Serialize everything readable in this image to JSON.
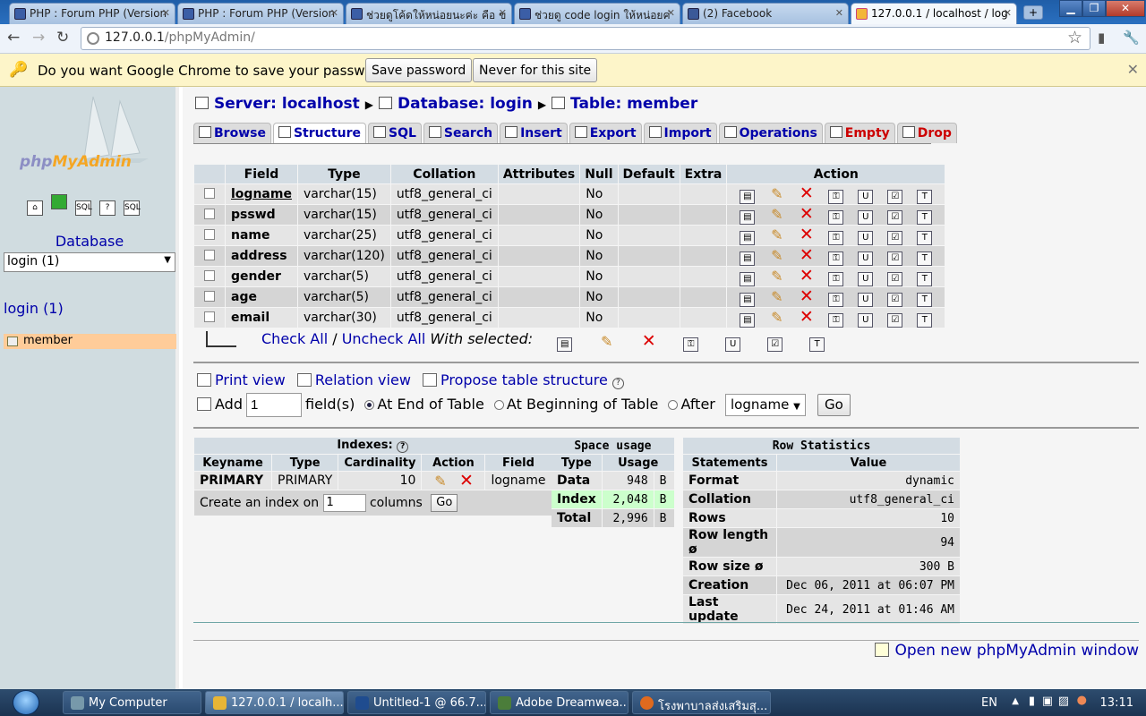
{
  "browser": {
    "tabs": [
      {
        "label": "PHP : Forum PHP (Version",
        "icon": "page-icon"
      },
      {
        "label": "PHP : Forum PHP (Version",
        "icon": "page-icon"
      },
      {
        "label": "ช่วยดูโค้ดให้หน่อยนะค่ะ คือ ข",
        "icon": "page-icon"
      },
      {
        "label": "ช่วยดู code login ให้หน่อยค่",
        "icon": "page-icon"
      },
      {
        "label": "(2) Facebook",
        "icon": "facebook-icon"
      },
      {
        "label": "127.0.0.1 / localhost / log",
        "icon": "phpmyadmin-icon"
      }
    ],
    "url_host": "127.0.0.1",
    "url_path": "/phpMyAdmin/",
    "infobar": {
      "message": "Do you want Google Chrome to save your password?",
      "save_label": "Save password",
      "never_label": "Never for this site"
    }
  },
  "sidebar": {
    "logo": {
      "php": "php",
      "myadmin": "MyAdmin"
    },
    "database_label": "Database",
    "database_selected": "login (1)",
    "db_title": "login (1)",
    "tables": [
      "member"
    ]
  },
  "breadcrumb": {
    "server": "Server: localhost",
    "database": "Database: login",
    "table": "Table: member"
  },
  "tabs": [
    {
      "label": "Browse"
    },
    {
      "label": "Structure"
    },
    {
      "label": "SQL"
    },
    {
      "label": "Search"
    },
    {
      "label": "Insert"
    },
    {
      "label": "Export"
    },
    {
      "label": "Import"
    },
    {
      "label": "Operations"
    },
    {
      "label": "Empty"
    },
    {
      "label": "Drop"
    }
  ],
  "structure": {
    "headers": [
      "Field",
      "Type",
      "Collation",
      "Attributes",
      "Null",
      "Default",
      "Extra",
      "Action"
    ],
    "rows": [
      {
        "field": "logname",
        "type": "varchar(15)",
        "collation": "utf8_general_ci",
        "attributes": "",
        "null": "No",
        "default": "",
        "extra": "",
        "primary": true
      },
      {
        "field": "psswd",
        "type": "varchar(15)",
        "collation": "utf8_general_ci",
        "attributes": "",
        "null": "No",
        "default": "",
        "extra": ""
      },
      {
        "field": "name",
        "type": "varchar(25)",
        "collation": "utf8_general_ci",
        "attributes": "",
        "null": "No",
        "default": "",
        "extra": ""
      },
      {
        "field": "address",
        "type": "varchar(120)",
        "collation": "utf8_general_ci",
        "attributes": "",
        "null": "No",
        "default": "",
        "extra": ""
      },
      {
        "field": "gender",
        "type": "varchar(5)",
        "collation": "utf8_general_ci",
        "attributes": "",
        "null": "No",
        "default": "",
        "extra": ""
      },
      {
        "field": "age",
        "type": "varchar(5)",
        "collation": "utf8_general_ci",
        "attributes": "",
        "null": "No",
        "default": "",
        "extra": ""
      },
      {
        "field": "email",
        "type": "varchar(30)",
        "collation": "utf8_general_ci",
        "attributes": "",
        "null": "No",
        "default": "",
        "extra": ""
      }
    ],
    "action_icons": [
      "browse-icon",
      "edit-icon",
      "delete-icon",
      "primary-icon",
      "unique-icon",
      "index-icon",
      "fulltext-icon"
    ],
    "check_all": "Check All",
    "uncheck_all": "Uncheck All",
    "with_selected": "With selected:"
  },
  "links": {
    "print_view": "Print view",
    "relation_view": "Relation view",
    "propose": "Propose table structure"
  },
  "add_fields": {
    "add_label": "Add",
    "count": "1",
    "fields_label": "field(s)",
    "at_end": "At End of Table",
    "at_beginning": "At Beginning of Table",
    "after": "After",
    "after_field": "logname",
    "go": "Go"
  },
  "indexes": {
    "caption": "Indexes:",
    "headers": [
      "Keyname",
      "Type",
      "Cardinality",
      "Action",
      "Field"
    ],
    "rows": [
      {
        "keyname": "PRIMARY",
        "type": "PRIMARY",
        "cardinality": "10",
        "field": "logname"
      }
    ],
    "create_label": "Create an index on",
    "columns_value": "1",
    "columns_label": "columns",
    "go": "Go"
  },
  "space_usage": {
    "caption": "Space usage",
    "headers": [
      "Type",
      "Usage"
    ],
    "rows": [
      {
        "type": "Data",
        "usage": "948",
        "unit": "B"
      },
      {
        "type": "Index",
        "usage": "2,048",
        "unit": "B"
      },
      {
        "type": "Total",
        "usage": "2,996",
        "unit": "B"
      }
    ]
  },
  "row_stats": {
    "caption": "Row Statistics",
    "headers": [
      "Statements",
      "Value"
    ],
    "rows": [
      {
        "label": "Format",
        "value": "dynamic"
      },
      {
        "label": "Collation",
        "value": "utf8_general_ci"
      },
      {
        "label": "Rows",
        "value": "10"
      },
      {
        "label": "Row length ø",
        "value": "94"
      },
      {
        "label": "Row size ø",
        "value": "300 B"
      },
      {
        "label": "Creation",
        "value": "Dec 06, 2011 at 06:07 PM"
      },
      {
        "label": "Last update",
        "value": "Dec 24, 2011 at 01:46 AM"
      }
    ]
  },
  "open_new": "Open new phpMyAdmin window",
  "taskbar": {
    "items": [
      {
        "label": "My Computer"
      },
      {
        "label": "127.0.0.1 / localh..."
      },
      {
        "label": "Untitled-1 @ 66.7..."
      },
      {
        "label": "Adobe Dreamwea..."
      },
      {
        "label": "โรงพาบาลส่งเสริมสุ..."
      }
    ],
    "lang": "EN",
    "time": "13:11"
  }
}
